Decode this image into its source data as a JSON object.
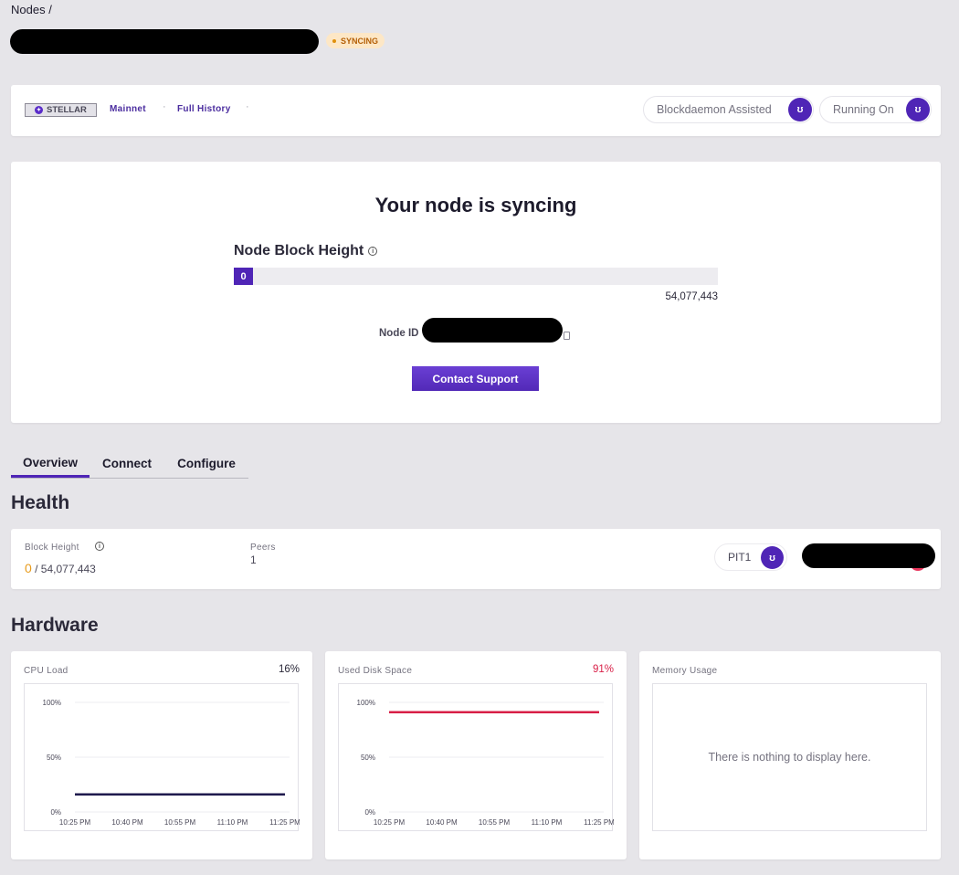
{
  "breadcrumb": "Nodes /",
  "status": "SYNCING",
  "protocol": {
    "name": "STELLAR",
    "network": "Mainnet",
    "type": "Full History",
    "assist_label": "Blockdaemon Assisted",
    "running_label": "Running On"
  },
  "sync": {
    "title": "Your node is syncing",
    "block_height_label": "Node Block Height",
    "current_height": "0",
    "progress_fraction": 0,
    "max_height": "54,077,443",
    "node_id_label": "Node ID",
    "contact_button": "Contact Support"
  },
  "tabs": [
    {
      "label": "Overview"
    },
    {
      "label": "Connect"
    },
    {
      "label": "Configure"
    }
  ],
  "health": {
    "title": "Health",
    "block_height_label": "Block Height",
    "block_height_current": "0",
    "block_height_total": " / 54,077,443",
    "peers_label": "Peers",
    "peers_value": "1",
    "region": "PIT1"
  },
  "hardware": {
    "title": "Hardware",
    "cpu": {
      "label": "CPU Load",
      "value": "16%"
    },
    "disk": {
      "label": "Used Disk Space",
      "value": "91%"
    },
    "memory": {
      "label": "Memory Usage",
      "empty_text": "There is nothing to display here."
    }
  },
  "chart_data": [
    {
      "type": "line",
      "title": "CPU Load",
      "x": [
        "10:25 PM",
        "10:40 PM",
        "10:55 PM",
        "11:10 PM",
        "11:25 PM"
      ],
      "y_ticks": [
        "100%",
        "50%",
        "0%"
      ],
      "ylim": [
        0,
        100
      ],
      "series": [
        {
          "values": [
            16,
            16,
            16,
            16,
            16
          ],
          "color": "#1f1a4d"
        }
      ]
    },
    {
      "type": "line",
      "title": "Used Disk Space",
      "x": [
        "10:25 PM",
        "10:40 PM",
        "10:55 PM",
        "11:10 PM",
        "11:25 PM"
      ],
      "y_ticks": [
        "100%",
        "50%",
        "0%"
      ],
      "ylim": [
        0,
        100
      ],
      "series": [
        {
          "values": [
            91,
            91,
            91,
            91,
            91
          ],
          "color": "#d81f47"
        }
      ]
    }
  ],
  "colors": {
    "accent": "#4f25b6",
    "syncing": "#b45f06",
    "alert": "#d81f47",
    "warning": "#e89b1b"
  }
}
